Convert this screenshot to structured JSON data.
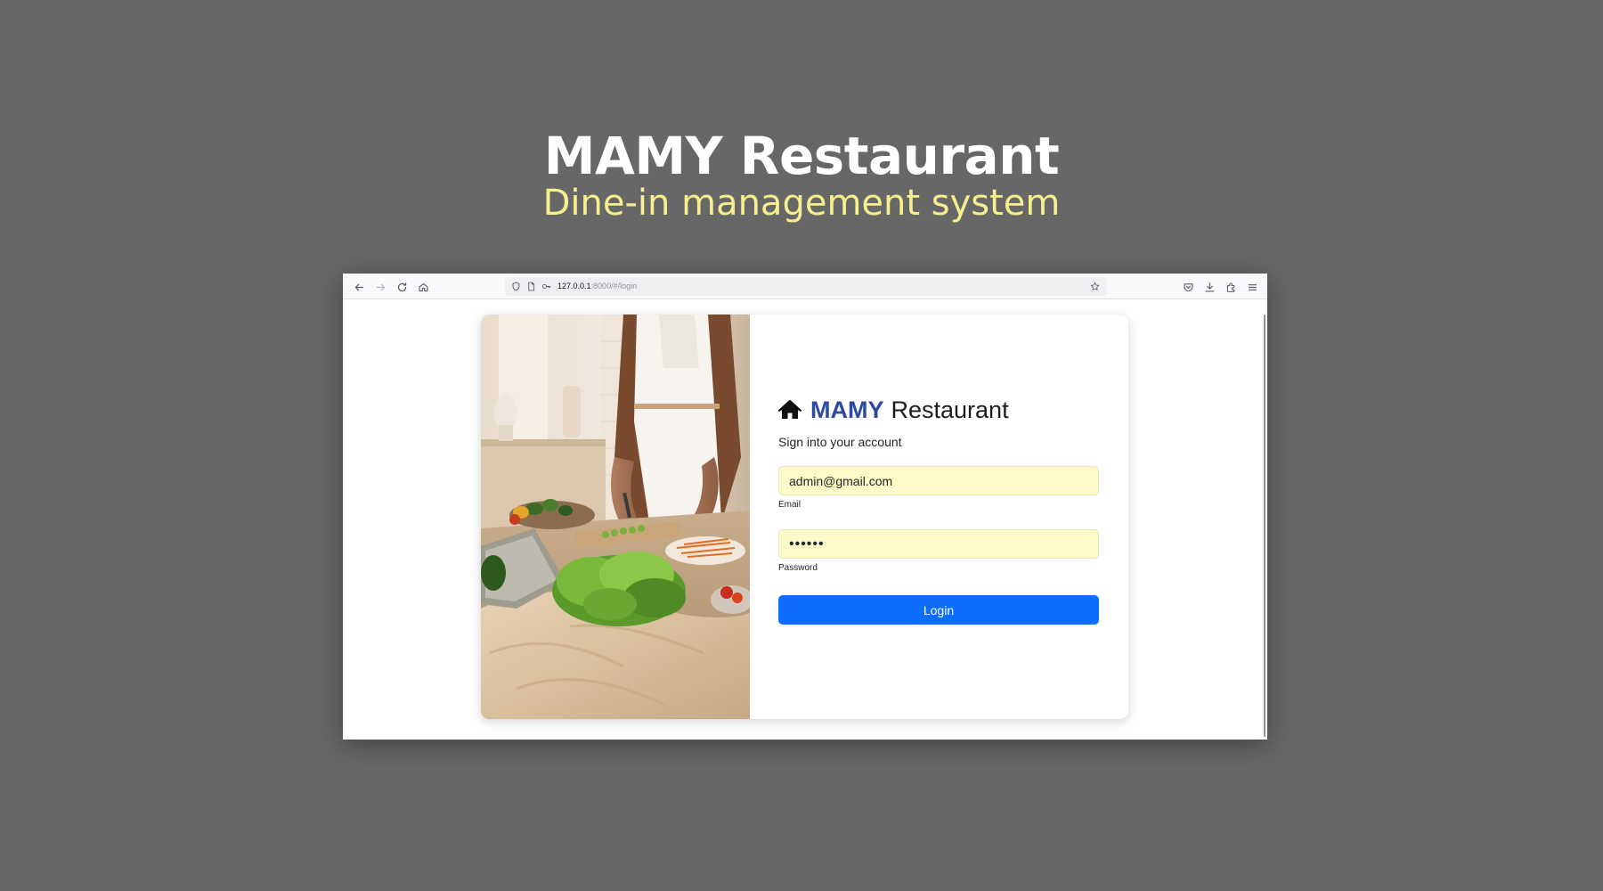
{
  "hero": {
    "title": "MAMY Restaurant",
    "subtitle": "Dine-in management system"
  },
  "browser": {
    "url_host": "127.0.0.1",
    "url_rest": ":8000/#/login",
    "toolbar_icons": [
      "back-arrow-icon",
      "forward-arrow-icon",
      "reload-icon",
      "home-icon",
      "shield-icon",
      "page-icon",
      "key-icon",
      "star-icon",
      "pocket-icon",
      "download-icon",
      "extensions-icon",
      "menu-icon"
    ]
  },
  "login": {
    "brand_strong": "MAMY",
    "brand_rest": "Restaurant",
    "brand_icon": "home-icon",
    "subtitle": "Sign into your account",
    "email": {
      "value": "admin@gmail.com",
      "label": "Email"
    },
    "password": {
      "value": "••••••",
      "label": "Password"
    },
    "button_label": "Login"
  },
  "colors": {
    "background": "#676767",
    "hero_title": "#ffffff",
    "hero_subtitle": "#f7ee8e",
    "brand_accent": "#2c4a9e",
    "primary_button": "#0d6efd",
    "autofill_field": "#fefac8"
  }
}
